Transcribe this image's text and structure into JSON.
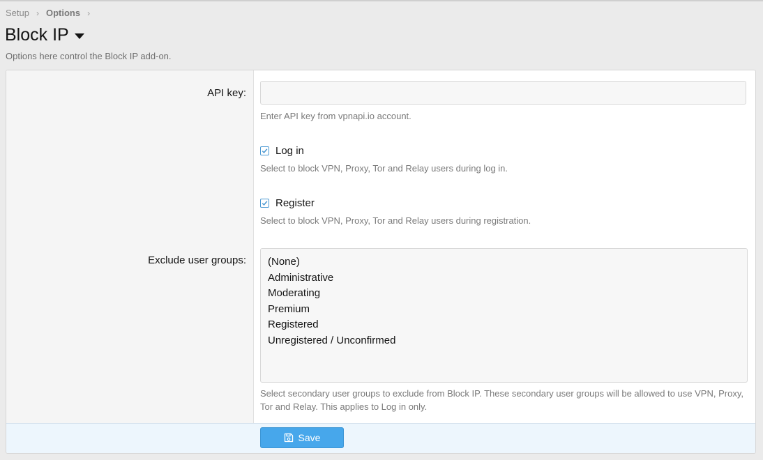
{
  "breadcrumb": {
    "items": [
      "Setup",
      "Options"
    ],
    "separator": "›"
  },
  "page": {
    "title": "Block IP",
    "description": "Options here control the Block IP add-on."
  },
  "form": {
    "api_key": {
      "label": "API key:",
      "value": "",
      "hint": "Enter API key from vpnapi.io account."
    },
    "login": {
      "label": "Log in",
      "checked": true,
      "hint": "Select to block VPN, Proxy, Tor and Relay users during log in."
    },
    "register": {
      "label": "Register",
      "checked": true,
      "hint": "Select to block VPN, Proxy, Tor and Relay users during registration."
    },
    "exclude_groups": {
      "label": "Exclude user groups:",
      "options": [
        "(None)",
        "Administrative",
        "Moderating",
        "Premium",
        "Registered",
        "Unregistered / Unconfirmed"
      ],
      "hint": "Select secondary user groups to exclude from Block IP. These secondary user groups will be allowed to use VPN, Proxy, Tor and Relay. This applies to Log in only."
    }
  },
  "footer": {
    "save_label": "Save"
  },
  "colors": {
    "accent": "#47a7eb",
    "checkbox": "#4a98d2",
    "footer_bg": "#edf6fd"
  }
}
